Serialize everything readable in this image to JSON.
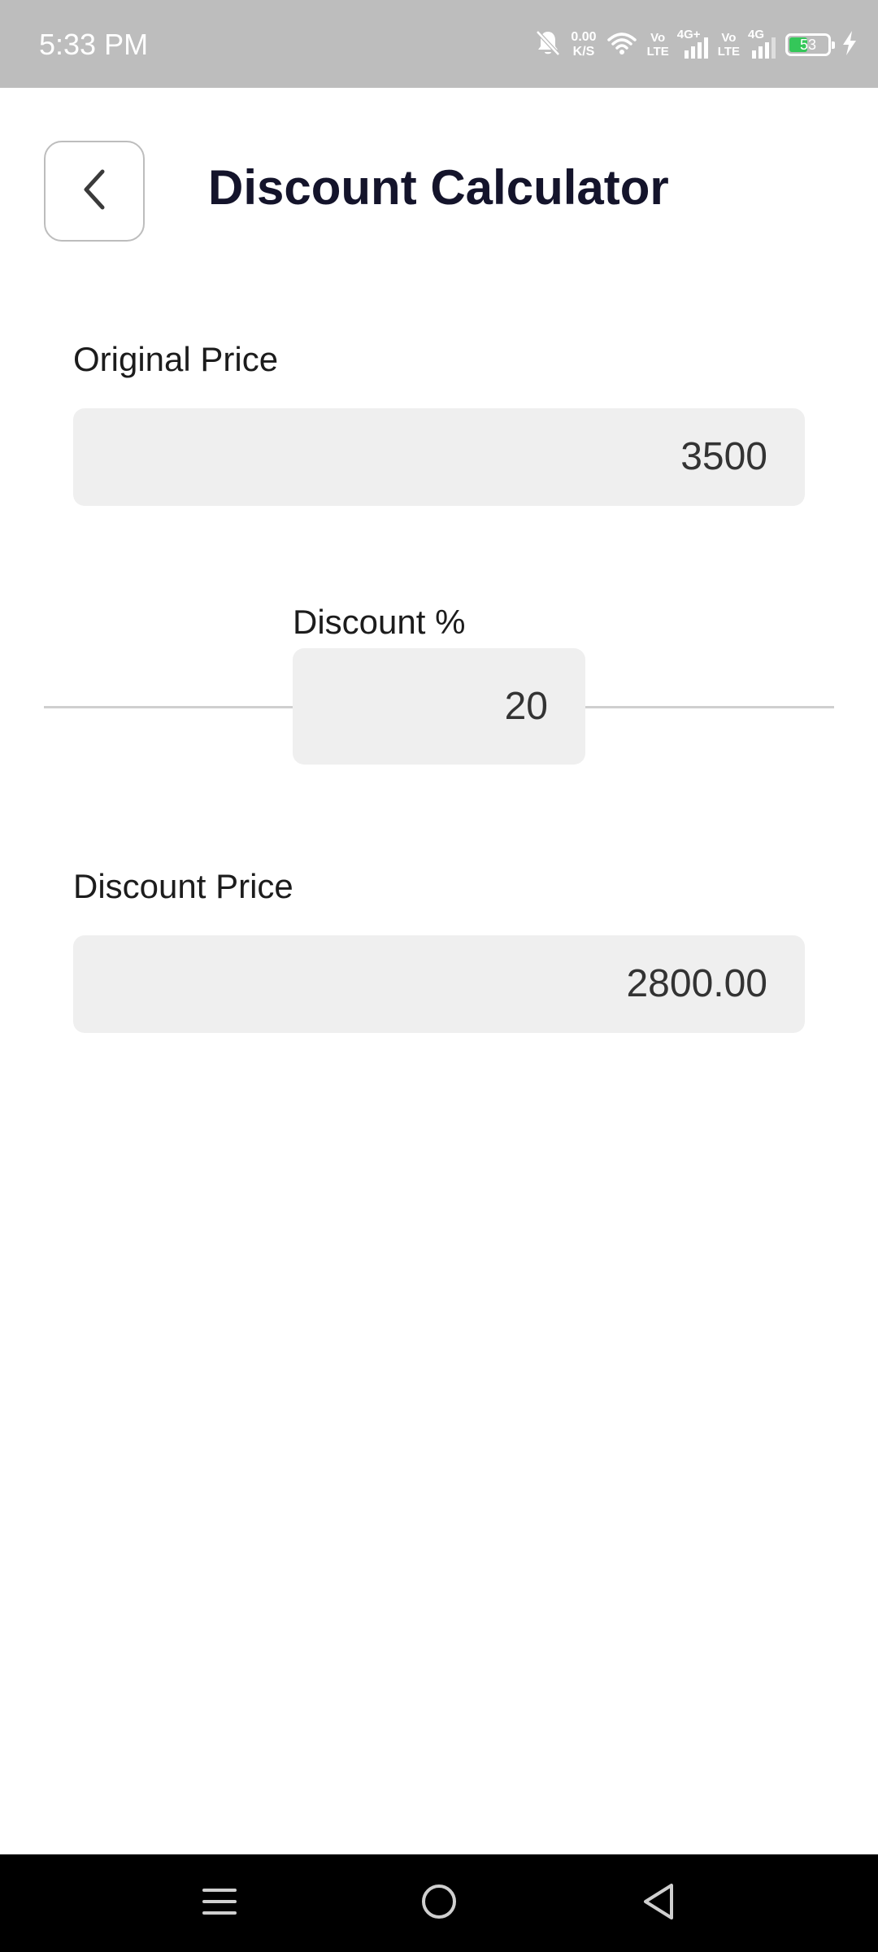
{
  "status_bar": {
    "time": "5:33 PM",
    "net_speed_value": "0.00",
    "net_speed_unit": "K/S",
    "sim1_top": "Vo",
    "sim1_bottom": "LTE",
    "sim1_network": "4G+",
    "sim2_top": "Vo",
    "sim2_bottom": "LTE",
    "sim2_network": "4G",
    "battery_level": "53",
    "battery_color": "#34c759",
    "icons": [
      "bell-muted-icon",
      "wifi-icon",
      "signal-icon",
      "battery-icon",
      "charging-icon"
    ]
  },
  "header": {
    "back_icon": "chevron-left-icon",
    "title": "Discount Calculator"
  },
  "form": {
    "original_price_label": "Original Price",
    "original_price_value": "3500",
    "discount_percent_label": "Discount %",
    "discount_percent_value": "20",
    "discount_price_label": "Discount Price",
    "discount_price_value": "2800.00"
  },
  "nav_bar": {
    "icons": [
      "menu-icon",
      "home-icon",
      "back-triangle-icon"
    ]
  }
}
